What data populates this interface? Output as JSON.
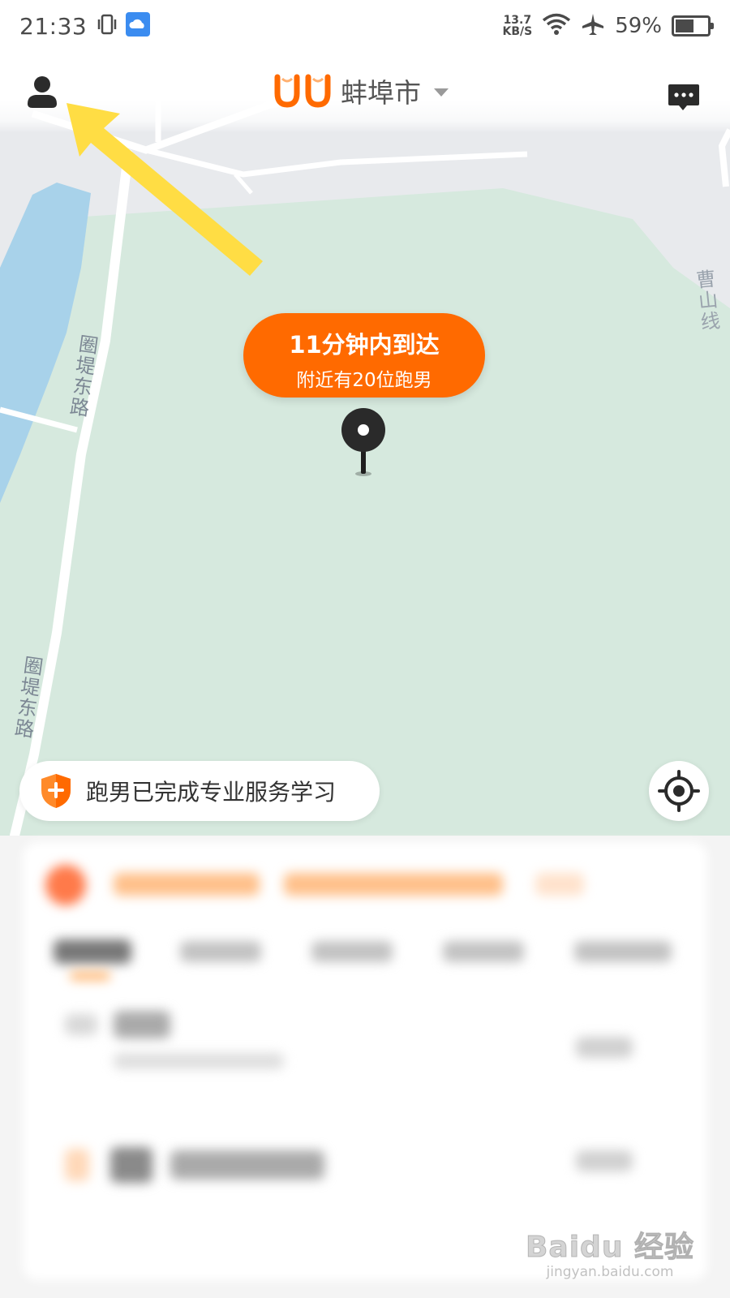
{
  "status_bar": {
    "time": "21:33",
    "net_speed_value": "13.7",
    "net_speed_unit": "KB/S",
    "battery_percent": "59%",
    "battery_level": 0.59,
    "icons": [
      "vibrate-icon",
      "cloud-icon",
      "wifi-icon",
      "airplane-icon",
      "battery-icon"
    ]
  },
  "header": {
    "brand": "UU",
    "city": "蚌埠市",
    "brand_color": "#ff6a00"
  },
  "map": {
    "road_labels": [
      "圈堤东路",
      "圈堤东路",
      "曹山线"
    ]
  },
  "eta": {
    "title": "11分钟内到达",
    "subtitle": "附近有20位跑男"
  },
  "safety_chip": {
    "label": "跑男已完成专业服务学习"
  },
  "watermark": {
    "logo": "Baidu 经验",
    "url": "jingyan.baidu.com"
  },
  "colors": {
    "accent": "#ff6a00",
    "annotation_arrow": "#ffdd44",
    "map_park": "#d6e9de",
    "map_water": "#a8d2ea"
  }
}
